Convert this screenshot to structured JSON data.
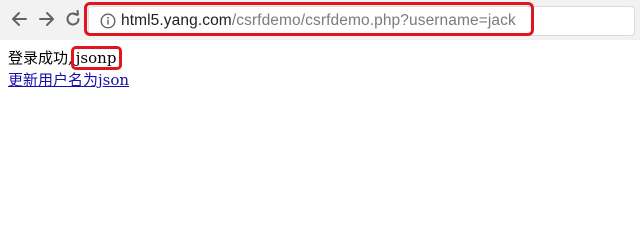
{
  "browser": {
    "address_bar": {
      "host": "html5.yang.com",
      "path": "/csrfdemo/csrfdemo.php?username=jack"
    },
    "icons": {
      "back": "back-arrow-icon",
      "forward": "forward-arrow-icon",
      "reload": "reload-icon",
      "info": "info-icon"
    }
  },
  "page": {
    "login_message": "登录成功,",
    "username": "jsonp",
    "update_link": "更新用户名为json"
  },
  "colors": {
    "highlight": "#e0151f",
    "link": "#1a0dab"
  }
}
